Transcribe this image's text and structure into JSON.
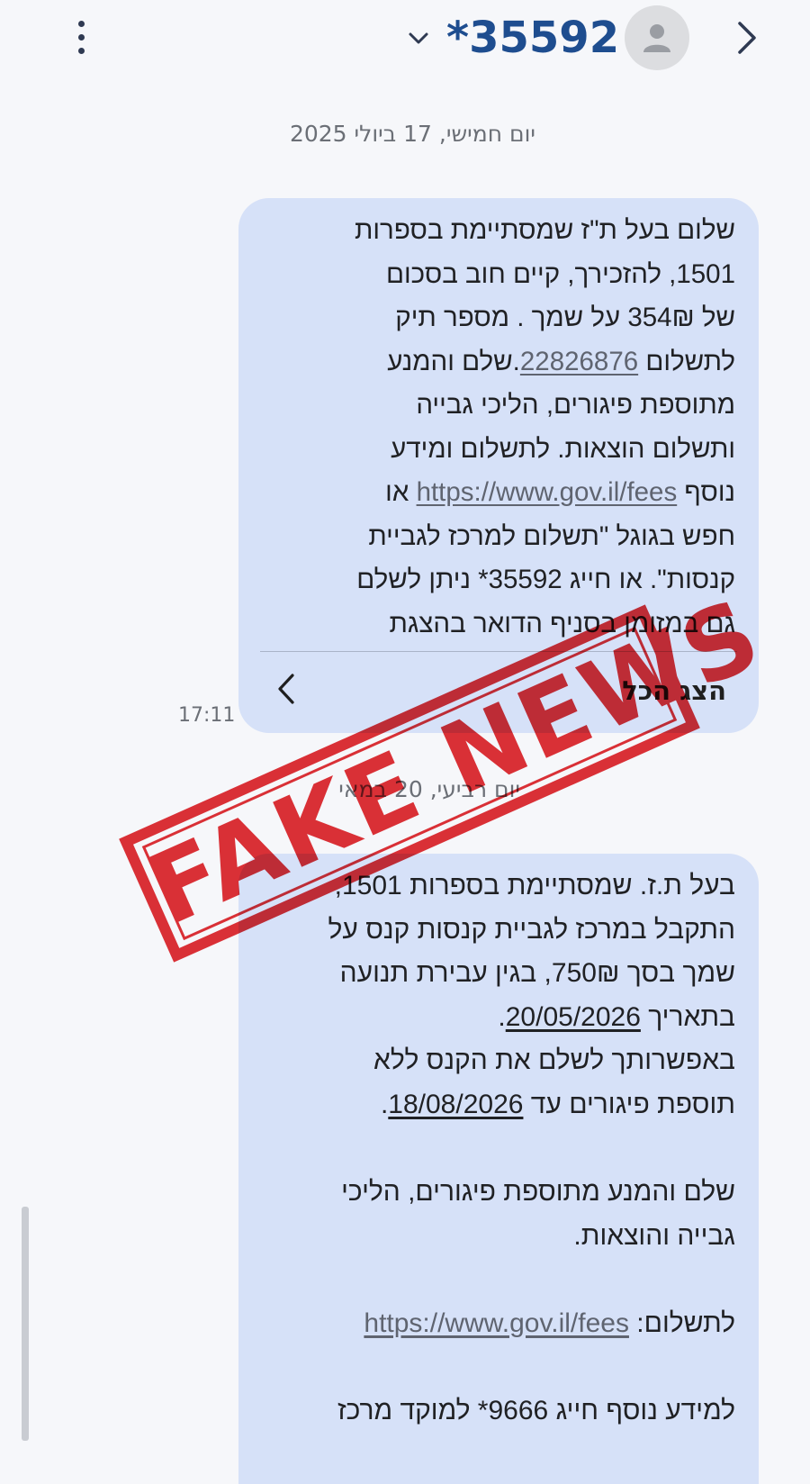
{
  "header": {
    "contact_number": "*35592",
    "menu_icon": "more-vert-icon",
    "chevron_icon": "chevron-down-icon",
    "avatar_icon": "person-icon",
    "back_icon": "chevron-right-icon"
  },
  "conversation": {
    "date_1": "יום חמישי, 17 ביולי 2025",
    "message_1": {
      "lines": [
        "שלום בעל ת\"ז שמסתיימת בספרות",
        "1501,   להזכירך, קיים חוב בסכום",
        "של  354₪ על שמך .    מספר תיק",
        "לתשלום ",
        "מתוספת פיגורים, הליכי גבייה",
        "ותשלום הוצאות.  לתשלום ומידע",
        "נוסף ",
        "חפש בגוגל \"תשלום למרכז לגביית",
        "קנסות\". או חייג 35592*  ניתן לשלם",
        "גם במזומן בסניף הדואר בהצגת"
      ],
      "case_number": "22826876",
      "line_4_tail": ".שלם והמנע",
      "link": "https://www.gov.il/fees",
      "line_7_tail": "  או",
      "show_all_label": "הצג הכל",
      "time": "17:11"
    },
    "date_2": "יום רביעי, 20 במאי",
    "message_2": {
      "line_1": "בעל ת.ז. שמסתיימת בספרות 1501,",
      "line_2": "התקבל במרכז לגביית קנסות קנס על",
      "line_3": "שמך בסך 750₪, בגין עבירת תנועה",
      "line_4_prefix": "בתאריך ",
      "date_offense": "20/05/2026",
      "line_5": "באפשרותך לשלם את הקנס ללא",
      "line_6_prefix": "תוספת פיגורים עד ",
      "date_due": "18/08/2026",
      "line_7": "שלם והמנע מתוספת פיגורים, הליכי",
      "line_8": "גבייה והוצאות.",
      "pay_label": "לתשלום: ",
      "link": "https://www.gov.il/fees",
      "line_10": "למידע נוסף חייג 9666* למוקד מרכז"
    }
  },
  "stamp": {
    "text": "FAKE NEWS",
    "color": "#e0282e"
  },
  "colors": {
    "accent": "#1e4d8f",
    "bubble": "#d6e1f8"
  }
}
